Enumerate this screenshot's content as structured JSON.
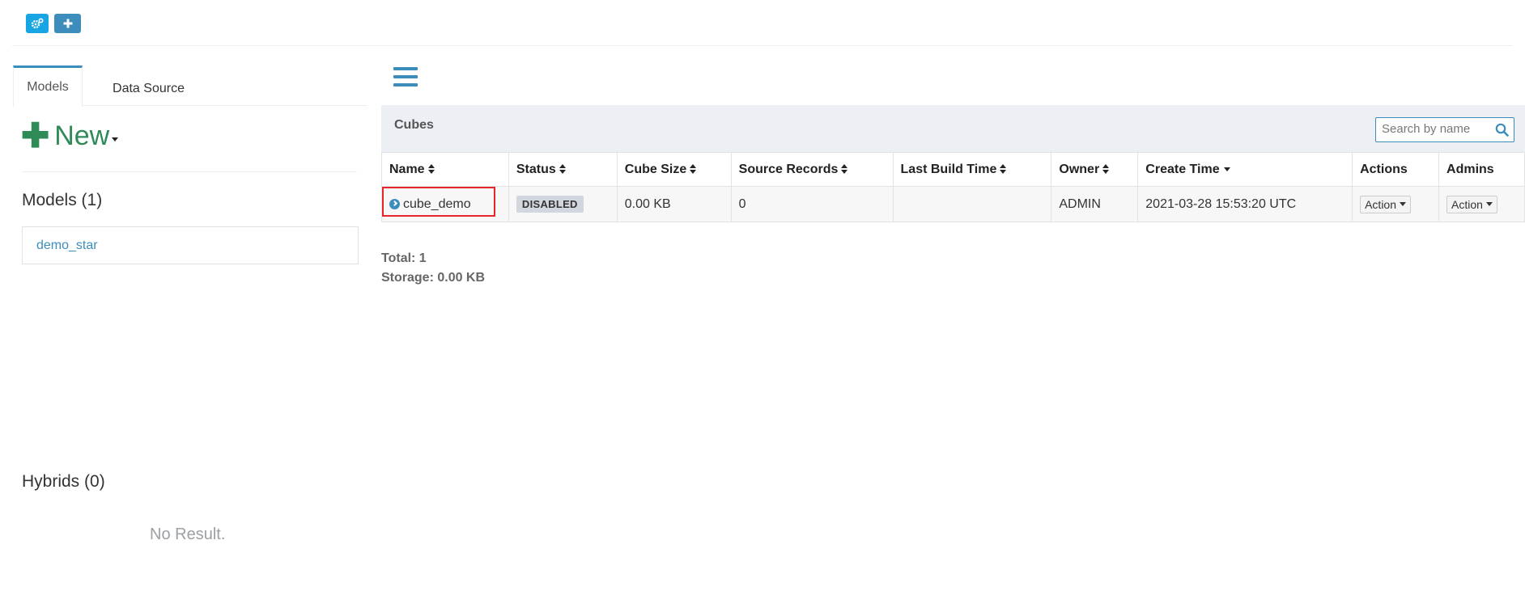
{
  "toolbar": {
    "gear_icon": "gears-icon",
    "plus_icon": "plus-icon",
    "gear_color": "#17a5e3",
    "plus_color": "#3c8dbc"
  },
  "left_panel": {
    "tabs": [
      {
        "label": "Models",
        "active": true
      },
      {
        "label": "Data Source",
        "active": false
      }
    ],
    "new_button": "New",
    "models_heading": "Models (1)",
    "models": [
      "demo_star"
    ],
    "hybrids_heading": "Hybrids (0)",
    "no_result": "No Result."
  },
  "cubes": {
    "title": "Cubes",
    "search_placeholder": "Search by name",
    "columns": [
      "Name",
      "Status",
      "Cube Size",
      "Source Records",
      "Last Build Time",
      "Owner",
      "Create Time",
      "Actions",
      "Admins"
    ],
    "rows": [
      {
        "name": "cube_demo",
        "status": "DISABLED",
        "cube_size": "0.00 KB",
        "source_records": "0",
        "last_build_time": "",
        "owner": "ADMIN",
        "create_time": "2021-03-28 15:53:20 UTC",
        "actions_label": "Action",
        "admins_label": "Action"
      }
    ],
    "total": "Total: 1",
    "storage": "Storage: 0.00 KB"
  },
  "colors": {
    "accent": "#3c8dbc",
    "new_green": "#2e8b57",
    "highlight": "#e8252a",
    "header_bg": "#ecf0f5"
  }
}
